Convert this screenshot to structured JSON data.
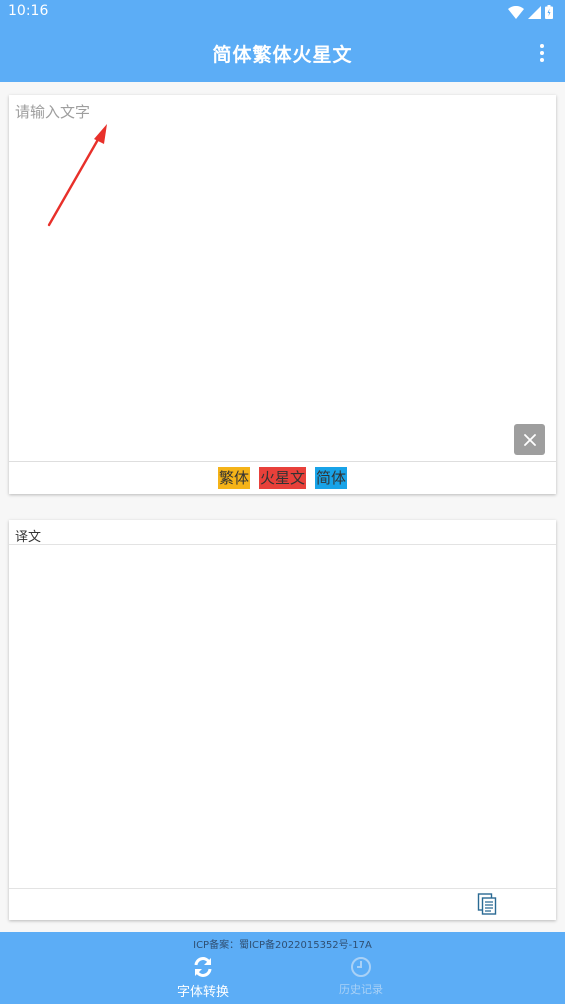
{
  "status_bar": {
    "time": "10:16"
  },
  "app_bar": {
    "title": "简体繁体火星文"
  },
  "input": {
    "placeholder": "请输入文字",
    "value": ""
  },
  "convert_buttons": [
    {
      "label": "繁体",
      "color": "#f5b318"
    },
    {
      "label": "火星文",
      "color": "#e8403a"
    },
    {
      "label": "简体",
      "color": "#18a3e8"
    }
  ],
  "output": {
    "label": "译文",
    "value": ""
  },
  "footer": {
    "icp": "ICP备案：蜀ICP备2022015352号-17A"
  },
  "bottom_nav": {
    "items": [
      {
        "label": "字体转换",
        "icon": "sync-icon",
        "active": true
      },
      {
        "label": "历史记录",
        "icon": "clock-icon",
        "active": false
      }
    ]
  },
  "colors": {
    "primary": "#5cadf6",
    "clear_button": "#9e9e9e",
    "annotation_arrow": "#e8302a"
  }
}
